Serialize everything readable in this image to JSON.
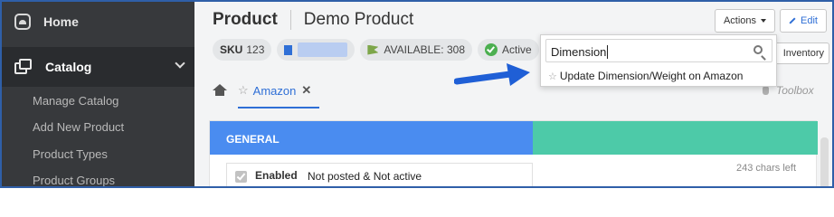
{
  "sidebar": {
    "home_label": "Home",
    "catalog_label": "Catalog",
    "sub_items": [
      "Manage Catalog",
      "Add New Product",
      "Product Types",
      "Product Groups"
    ]
  },
  "header": {
    "title": "Product",
    "product_name": "Demo Product",
    "actions_label": "Actions",
    "edit_label": "Edit",
    "inventory_label": "Inventory"
  },
  "chips": {
    "sku_key": "SKU",
    "sku_value": "123",
    "available": "AVAILABLE: 308",
    "status": "Active"
  },
  "tabs": {
    "amazon_label": "Amazon",
    "close_symbol": "✕",
    "toolbox_label": "Toolbox"
  },
  "panel": {
    "section_title": "GENERAL",
    "enabled_label": "Enabled",
    "status_text": "Not posted & Not active",
    "chars_left": "243 chars left"
  },
  "dropdown": {
    "search_value": "Dimension",
    "result_item": "Update Dimension/Weight on Amazon"
  },
  "colors": {
    "accent": "#2f6fd6",
    "sidebar_bg": "#37393c",
    "band_blue": "#4a8cf0",
    "band_green": "#4dcaa8",
    "annotation_arrow": "#1f5fd6"
  },
  "icons": [
    "home-icon",
    "catalog-icon",
    "chevron-down-icon",
    "store-icon",
    "flag-icon",
    "check-icon",
    "star-icon",
    "search-icon",
    "microphone-icon",
    "pencil-icon",
    "close-icon",
    "arrow-icon"
  ]
}
